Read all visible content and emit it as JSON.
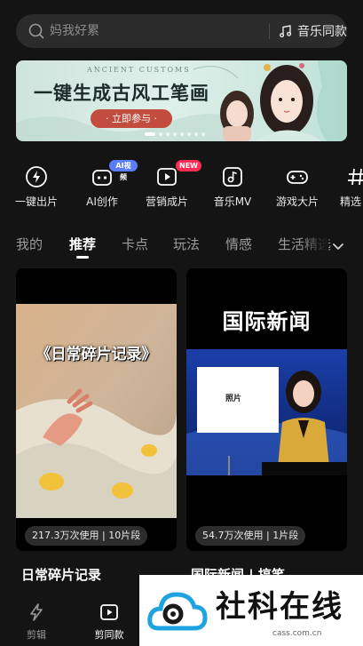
{
  "search": {
    "placeholder": "妈我好累",
    "music_label": "音乐同款"
  },
  "banner": {
    "subtitle": "ANCIENT CUSTOMS",
    "title": "一键生成古风工笔画",
    "cta": "· 立即参与 ·"
  },
  "shortcuts": [
    {
      "label": "一键出片",
      "icon": "lightning-icon"
    },
    {
      "label": "AI创作",
      "icon": "ai-robot-icon",
      "badge": "AI视频"
    },
    {
      "label": "营销成片",
      "icon": "play-frame-icon",
      "badge": "NEW"
    },
    {
      "label": "音乐MV",
      "icon": "music-note-icon"
    },
    {
      "label": "游戏大片",
      "icon": "gamepad-icon"
    },
    {
      "label": "精选",
      "icon": "hash-icon"
    }
  ],
  "tabs": [
    "我的",
    "推荐",
    "卡点",
    "玩法",
    "情感",
    "生活精选"
  ],
  "active_tab": "推荐",
  "cards": [
    {
      "overlay": "《日常碎片记录》",
      "usage": "217.3万次使用",
      "clips": "10片段",
      "title": "日常碎片记录"
    },
    {
      "headline": "国际新闻",
      "photo_label": "照片",
      "usage": "54.7万次使用",
      "clips": "1片段",
      "title": "国际新闻 | 搞笑"
    }
  ],
  "bottom_nav": [
    {
      "label": "剪辑",
      "icon": "scissors-icon"
    },
    {
      "label": "剪同款",
      "icon": "template-icon",
      "active": true
    }
  ],
  "watermark": {
    "title": "社科在线",
    "url": "cass.com.cn"
  },
  "colors": {
    "background": "#141414",
    "banner_cta": "#c24c3d",
    "badge_ai": "#5a7cff",
    "badge_new": "#ff2d55"
  }
}
